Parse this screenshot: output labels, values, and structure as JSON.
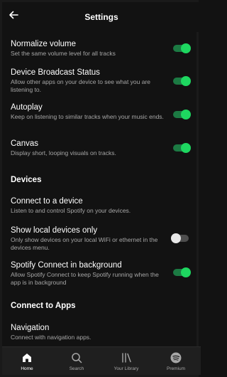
{
  "header": {
    "title": "Settings",
    "back_icon": "arrow-left-icon"
  },
  "settings": [
    {
      "title": "Normalize volume",
      "desc": "Set the same volume level for all tracks",
      "on": true
    },
    {
      "title": "Device Broadcast Status",
      "desc": "Allow other apps on your device to see what you are listening to.",
      "on": true
    },
    {
      "title": "Autoplay",
      "desc": "Keep on listening to similar tracks when your music ends.",
      "on": true
    },
    {
      "title": "Canvas",
      "desc": "Display short, looping visuals on tracks.",
      "on": true
    }
  ],
  "devices": {
    "heading": "Devices",
    "connect": {
      "title": "Connect to a device",
      "desc": "Listen to and control Spotify on your devices."
    },
    "local": {
      "title": "Show local devices only",
      "desc": "Only show devices on your local WiFi or ethernet in the devices menu.",
      "on": false
    },
    "background": {
      "title": "Spotify Connect in background",
      "desc": "Allow Spotify Connect to keep Spotify running when the app is in background",
      "on": true
    }
  },
  "apps": {
    "heading": "Connect to Apps",
    "navigation": {
      "title": "Navigation",
      "desc": "Connect with navigation apps."
    }
  },
  "tabs": [
    {
      "label": "Home",
      "icon": "home-icon",
      "active": true
    },
    {
      "label": "Search",
      "icon": "search-icon",
      "active": false
    },
    {
      "label": "Your Library",
      "icon": "library-icon",
      "active": false
    },
    {
      "label": "Premium",
      "icon": "spotify-logo-icon",
      "active": false
    }
  ],
  "colors": {
    "accent": "#1ed760",
    "background": "#121212",
    "secondary_text": "#a7a7a7"
  }
}
